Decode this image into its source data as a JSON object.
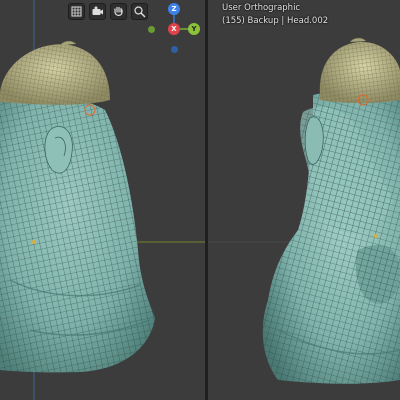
{
  "left_viewport": {
    "name": "Left 3D viewport",
    "tools": [
      {
        "name": "grid-toggle",
        "icon": "grid-icon"
      },
      {
        "name": "camera-view",
        "icon": "camera-icon"
      },
      {
        "name": "pan-view",
        "icon": "hand-icon"
      },
      {
        "name": "zoom-view",
        "icon": "magnifier-icon"
      }
    ],
    "gizmo": {
      "z_label": "Z",
      "x_label": "X",
      "y_label": "Y",
      "colors": {
        "x": "#e0424a",
        "y": "#8bc23a",
        "z": "#3d82e8"
      }
    }
  },
  "right_viewport": {
    "title": "User Orthographic",
    "subtitle": "(155) Backup | Head.002"
  },
  "colors": {
    "background": "#3c3c3c",
    "mesh_skin": "#7fb3ac",
    "mesh_cap": "#b9b58c",
    "wire": "#2c4a46",
    "cursor": "#d8b040"
  }
}
